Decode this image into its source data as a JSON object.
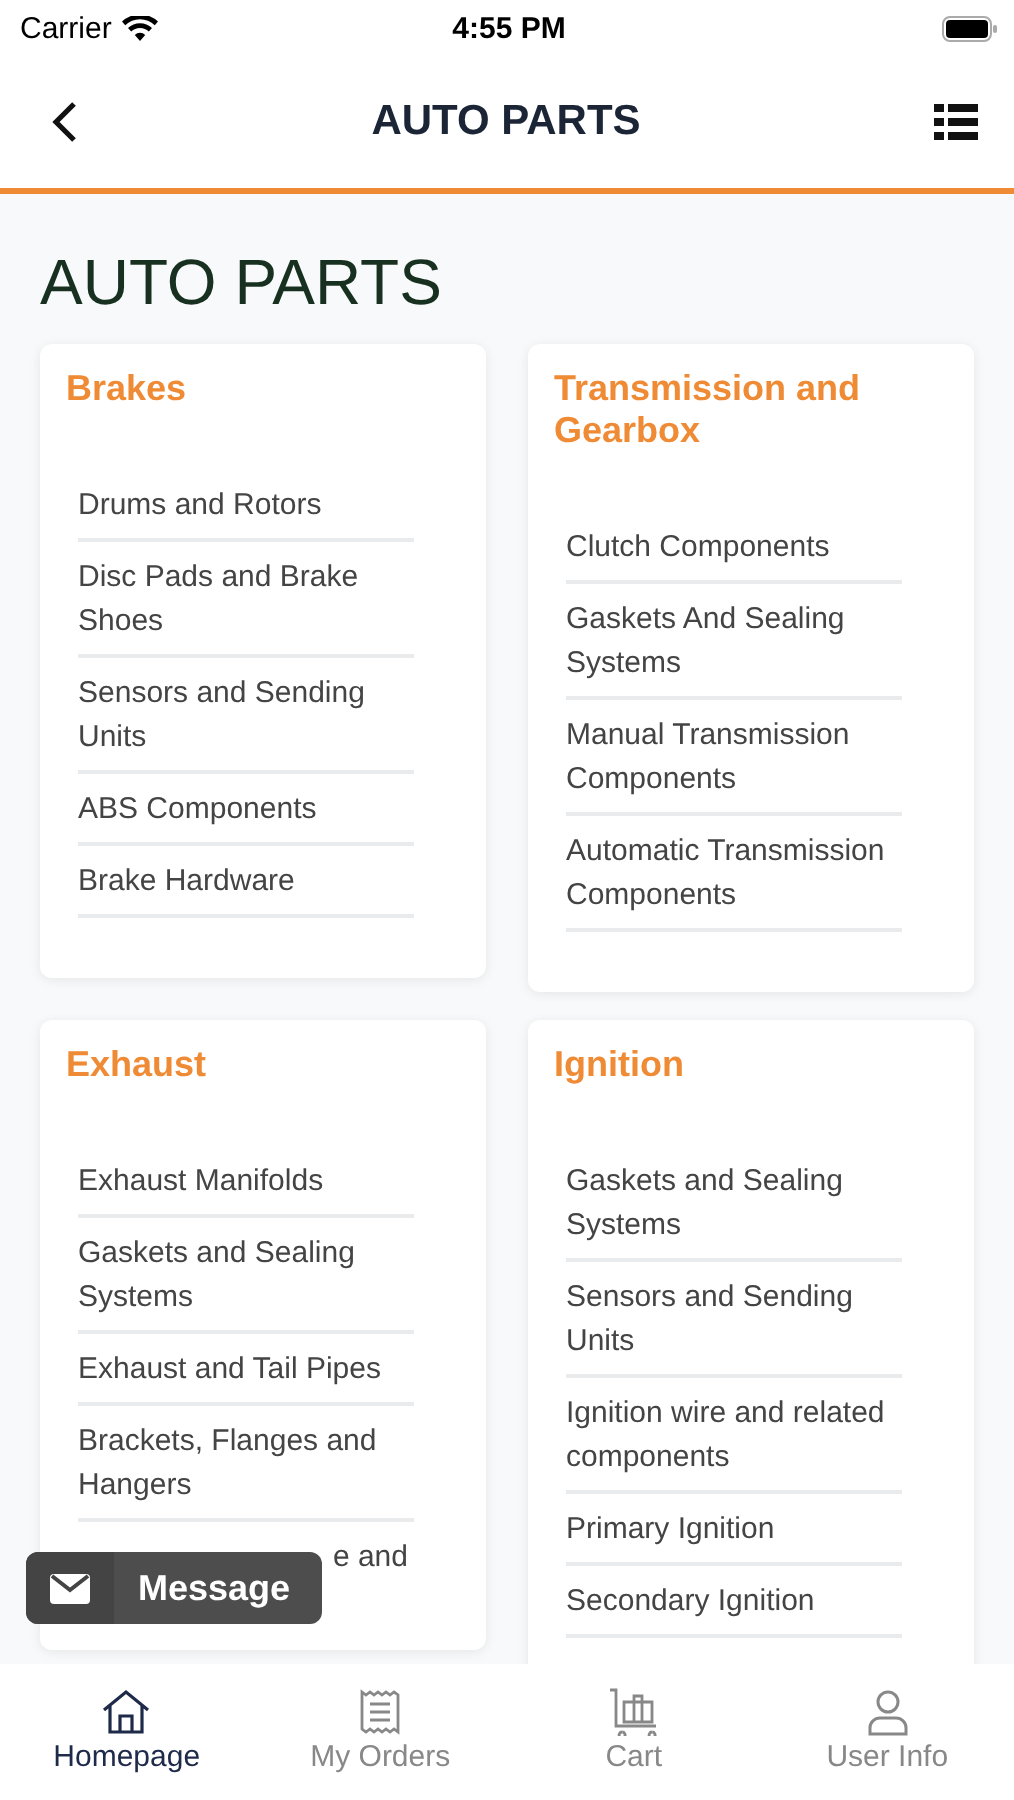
{
  "status_bar": {
    "carrier": "Carrier",
    "time": "4:55 PM"
  },
  "header": {
    "title": "AUTO PARTS"
  },
  "page_title": "AUTO PARTS",
  "categories": [
    {
      "title": "Brakes",
      "items": [
        {
          "label": "Drums and Rotors"
        },
        {
          "label": "Disc Pads and Brake Shoes"
        },
        {
          "label": "Sensors and Sending Units"
        },
        {
          "label": "ABS Components"
        },
        {
          "label": "Brake Hardware"
        }
      ]
    },
    {
      "title": "Transmission and Gearbox",
      "items": [
        {
          "label": "Clutch Components"
        },
        {
          "label": "Gaskets And Sealing Systems"
        },
        {
          "label": "Manual Transmission Components"
        },
        {
          "label": "Automatic Transmission Components"
        }
      ]
    },
    {
      "title": "Exhaust",
      "items": [
        {
          "label": "Exhaust Manifolds"
        },
        {
          "label": "Gaskets and Sealing Systems"
        },
        {
          "label": "Exhaust and Tail Pipes"
        },
        {
          "label": "Brackets, Flanges and Hangers"
        },
        {
          "label": "e and",
          "kind": "partial"
        }
      ]
    },
    {
      "title": "Ignition",
      "items": [
        {
          "label": "Gaskets and Sealing Systems"
        },
        {
          "label": "Sensors and Sending Units"
        },
        {
          "label": "Ignition wire and related components"
        },
        {
          "label": "Primary Ignition"
        },
        {
          "label": "Secondary Ignition"
        }
      ]
    }
  ],
  "message_button": {
    "label": "Message"
  },
  "tab_bar": [
    {
      "label": "Homepage",
      "kind": "home",
      "selected": true
    },
    {
      "label": "My Orders",
      "kind": "orders",
      "selected": false
    },
    {
      "label": "Cart",
      "kind": "cart",
      "selected": false
    },
    {
      "label": "User Info",
      "kind": "user",
      "selected": false
    }
  ]
}
